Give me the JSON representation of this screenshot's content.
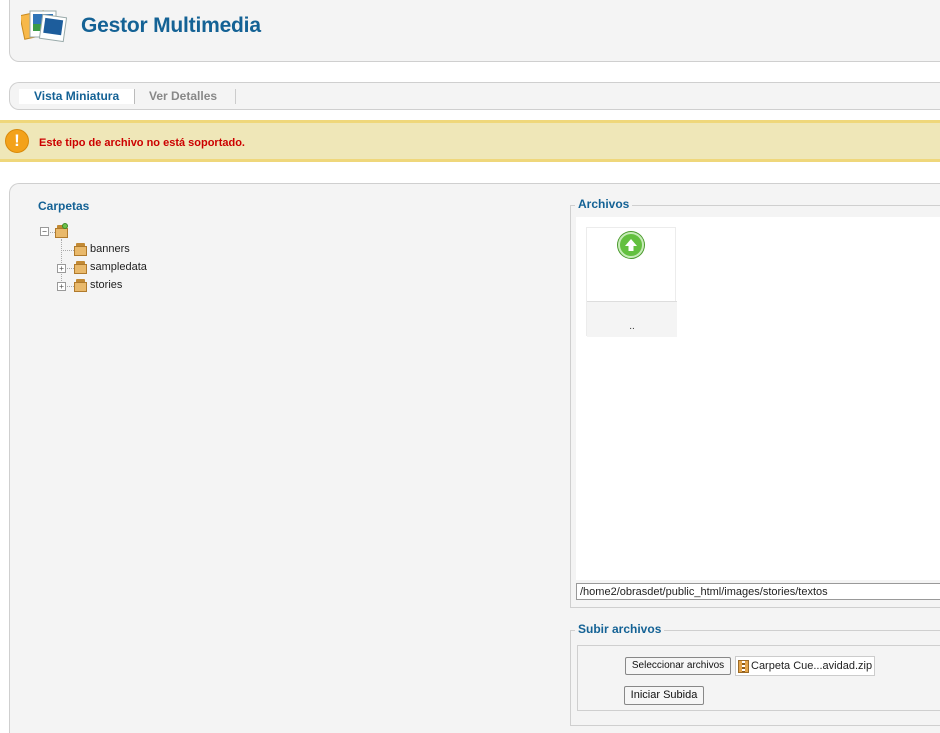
{
  "header": {
    "title": "Gestor Multimedia",
    "logo_icon": "media-images-icon"
  },
  "tabs": [
    {
      "label": "Vista Miniatura",
      "active": true
    },
    {
      "label": "Ver Detalles",
      "active": false
    }
  ],
  "alert": {
    "icon": "warning-icon",
    "message": "Este tipo de archivo no está soportado."
  },
  "folders": {
    "title": "Carpetas",
    "items": [
      {
        "label": "banners"
      },
      {
        "label": "sampledata"
      },
      {
        "label": "stories"
      }
    ]
  },
  "files": {
    "title": "Archivos",
    "items": [
      {
        "label": "..",
        "icon": "folder-up-icon"
      }
    ],
    "path": "/home2/obrasdet/public_html/images/stories/textos"
  },
  "upload": {
    "title": "Subir archivos",
    "select_label": "Seleccionar archivos",
    "selected_file": "Carpeta Cue...avidad.zip",
    "start_label": "Iniciar Subida"
  },
  "colors": {
    "accent": "#146295",
    "error": "#cc0000",
    "alert_bg": "#efe7b8"
  }
}
